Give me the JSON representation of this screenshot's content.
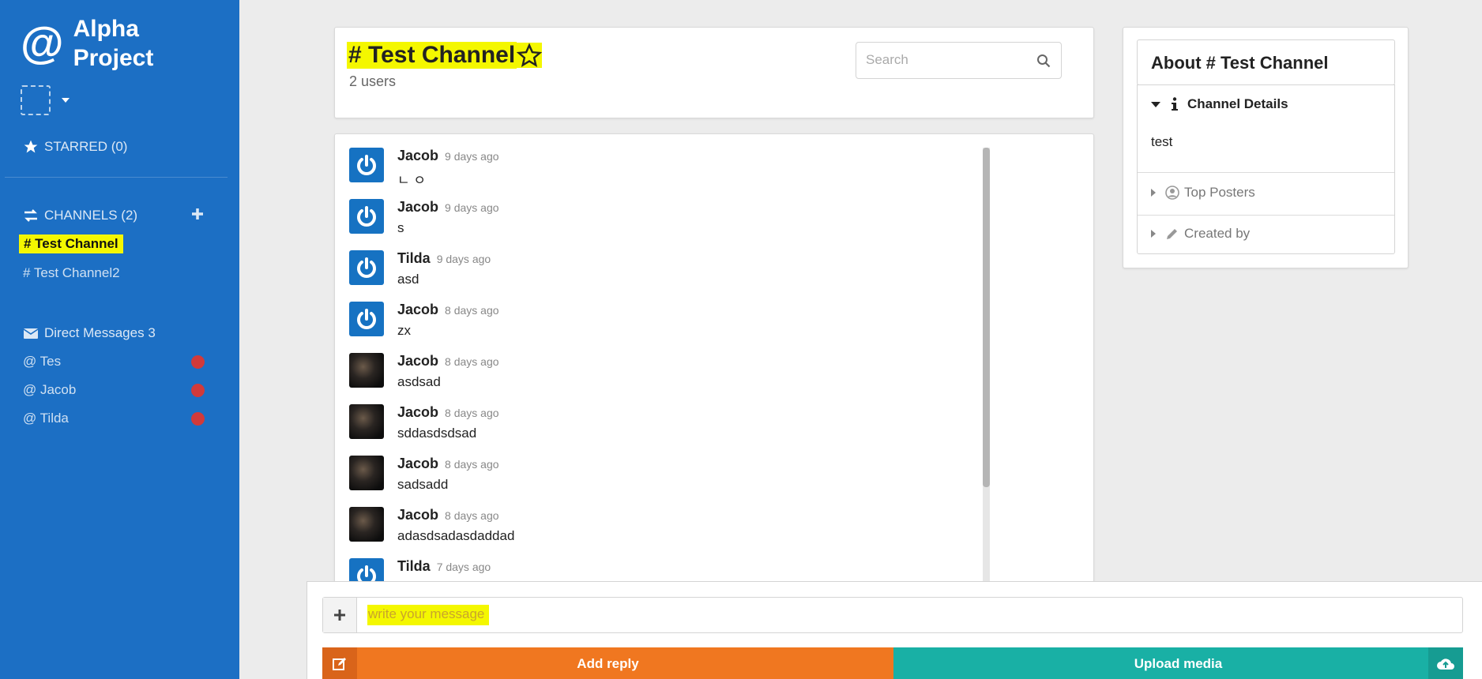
{
  "sidebar": {
    "brand_symbol": "@",
    "brand_line1": "Alpha",
    "brand_line2": "Project",
    "starred_label": "STARRED (0)",
    "channels_label": "CHANNELS (2)",
    "channels": [
      "# Test Channel",
      "# Test Channel2"
    ],
    "dm_label": "Direct Messages 3",
    "dms": [
      "@ Tes",
      "@ Jacob",
      "@ Tilda"
    ],
    "colors": {
      "background": "#1c6fc4",
      "highlight": "#f4f700",
      "unread_dot": "#d13a3a"
    }
  },
  "header": {
    "channel_title": "# Test Channel",
    "user_count": "2 users",
    "search_placeholder": "Search"
  },
  "messages": [
    {
      "author": "Jacob",
      "time": "9 days ago",
      "text": "ㄴ ㅇ",
      "avatar": "power-icon"
    },
    {
      "author": "Jacob",
      "time": "9 days ago",
      "text": "s",
      "avatar": "power-icon"
    },
    {
      "author": "Tilda",
      "time": "9 days ago",
      "text": "asd",
      "avatar": "power-icon"
    },
    {
      "author": "Jacob",
      "time": "8 days ago",
      "text": "zx",
      "avatar": "power-icon"
    },
    {
      "author": "Jacob",
      "time": "8 days ago",
      "text": "asdsad",
      "avatar": "photo"
    },
    {
      "author": "Jacob",
      "time": "8 days ago",
      "text": "sddasdsdsad",
      "avatar": "photo"
    },
    {
      "author": "Jacob",
      "time": "8 days ago",
      "text": "sadsadd",
      "avatar": "photo"
    },
    {
      "author": "Jacob",
      "time": "8 days ago",
      "text": "adasdsadasdaddad",
      "avatar": "photo"
    },
    {
      "author": "Tilda",
      "time": "7 days ago",
      "text": "",
      "avatar": "power-icon"
    }
  ],
  "about": {
    "title": "About # Test Channel",
    "details_label": "Channel Details",
    "details_text": "test",
    "top_posters_label": "Top Posters",
    "created_by_label": "Created by"
  },
  "composer": {
    "placeholder": "write your message",
    "reply_label": "Add reply",
    "upload_label": "Upload media",
    "colors": {
      "reply": "#f07720",
      "upload": "#19b0a5"
    }
  }
}
